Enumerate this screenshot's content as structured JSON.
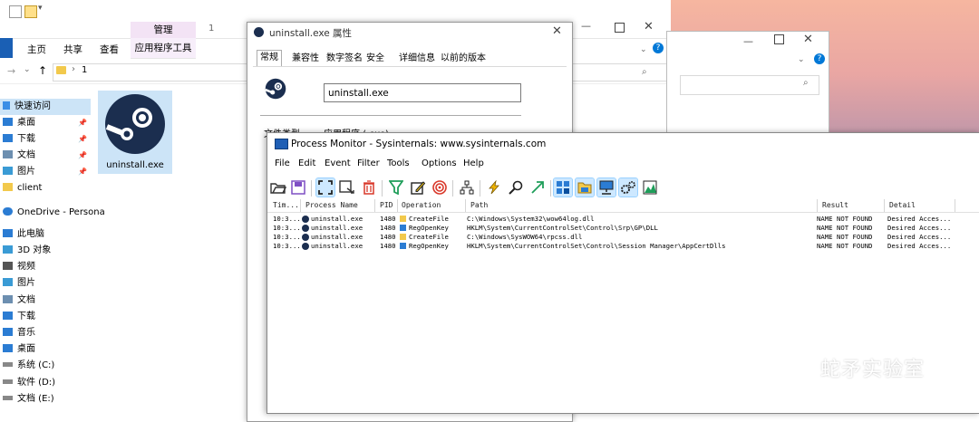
{
  "explorer": {
    "ribbon_tabs": [
      "主页",
      "共享",
      "查看"
    ],
    "context_group": "管理",
    "context_tab": "应用程序工具",
    "window_label": "1",
    "address_path": "1",
    "nav_quick_access": "快速访问",
    "nav_items": [
      {
        "label": "桌面",
        "icon": "desktop-icon",
        "pinned": true
      },
      {
        "label": "下载",
        "icon": "download-icon",
        "pinned": true
      },
      {
        "label": "文档",
        "icon": "documents-icon",
        "pinned": true
      },
      {
        "label": "图片",
        "icon": "pictures-icon",
        "pinned": true
      },
      {
        "label": "client",
        "icon": "folder-icon",
        "pinned": false
      }
    ],
    "nav_onedrive": "OneDrive - Persona",
    "nav_this_pc": "此电脑",
    "pc_items": [
      {
        "label": "3D 对象",
        "icon": "3d-objects-icon"
      },
      {
        "label": "视频",
        "icon": "videos-icon"
      },
      {
        "label": "图片",
        "icon": "pictures-icon"
      },
      {
        "label": "文档",
        "icon": "documents-icon"
      },
      {
        "label": "下载",
        "icon": "download-icon"
      },
      {
        "label": "音乐",
        "icon": "music-icon"
      },
      {
        "label": "桌面",
        "icon": "desktop-icon"
      },
      {
        "label": "系统 (C:)",
        "icon": "drive-icon"
      },
      {
        "label": "软件 (D:)",
        "icon": "drive-icon"
      },
      {
        "label": "文档 (E:)",
        "icon": "drive-icon"
      }
    ],
    "file_name": "uninstall.exe"
  },
  "properties": {
    "title": "uninstall.exe 属性",
    "tabs": [
      "常规",
      "兼容性",
      "数字签名",
      "安全",
      "详细信息",
      "以前的版本"
    ],
    "selected_tab": "常规",
    "file_name_value": "uninstall.exe",
    "file_type_label": "文件类型:",
    "file_type_value": "应用程序 (.exe)"
  },
  "procmon": {
    "title": "Process Monitor - Sysinternals: www.sysinternals.com",
    "menu": [
      "File",
      "Edit",
      "Event",
      "Filter",
      "Tools",
      "Options",
      "Help"
    ],
    "columns": [
      "Tim...",
      "Process Name",
      "PID",
      "Operation",
      "Path",
      "Result",
      "Detail"
    ],
    "rows": [
      {
        "time": "10:3...",
        "process": "uninstall.exe",
        "pid": "1480",
        "op": "CreateFile",
        "op_icon": "file-icon",
        "path": "C:\\Windows\\System32\\wow64log.dll",
        "result": "NAME NOT FOUND",
        "detail": "Desired Acces..."
      },
      {
        "time": "10:3...",
        "process": "uninstall.exe",
        "pid": "1480",
        "op": "RegOpenKey",
        "op_icon": "registry-icon",
        "path": "HKLM\\System\\CurrentControlSet\\Control\\Srp\\GP\\DLL",
        "result": "NAME NOT FOUND",
        "detail": "Desired Acces..."
      },
      {
        "time": "10:3...",
        "process": "uninstall.exe",
        "pid": "1480",
        "op": "CreateFile",
        "op_icon": "file-icon",
        "path": "C:\\Windows\\SysWOW64\\rpcss.dll",
        "result": "NAME NOT FOUND",
        "detail": "Desired Acces..."
      },
      {
        "time": "10:3...",
        "process": "uninstall.exe",
        "pid": "1480",
        "op": "RegOpenKey",
        "op_icon": "registry-icon",
        "path": "HKLM\\System\\CurrentControlSet\\Control\\Session Manager\\AppCertDlls",
        "result": "NAME NOT FOUND",
        "detail": "Desired Acces..."
      }
    ]
  },
  "watermark": "蛇矛实验室",
  "colors": {
    "steam": "#1b2e4f",
    "accent": "#0078d7",
    "context_tab": "#f3e3f5"
  }
}
